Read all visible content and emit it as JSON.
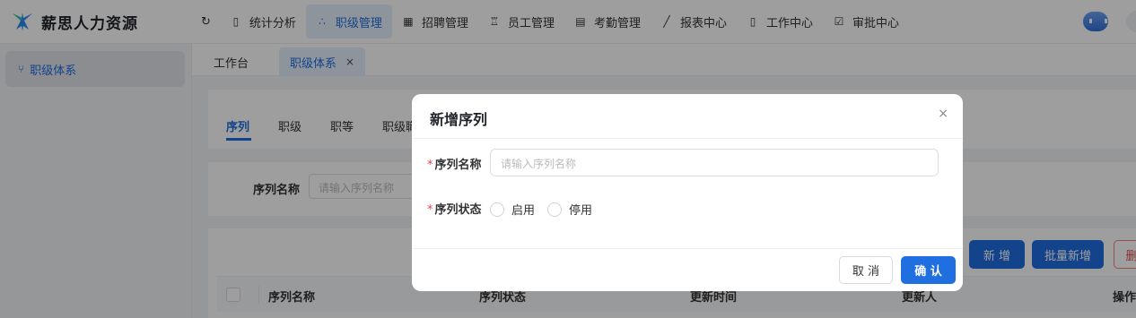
{
  "app": {
    "brand": "薪思人力资源"
  },
  "topnav": {
    "items": [
      {
        "label": "统计分析",
        "icon": "document-icon"
      },
      {
        "label": "职级管理",
        "icon": "org-icon"
      },
      {
        "label": "招聘管理",
        "icon": "grid-icon"
      },
      {
        "label": "员工管理",
        "icon": "people-icon"
      },
      {
        "label": "考勤管理",
        "icon": "calendar-icon"
      },
      {
        "label": "报表中心",
        "icon": "chart-icon"
      },
      {
        "label": "工作中心",
        "icon": "document-icon"
      },
      {
        "label": "审批中心",
        "icon": "checkbox-icon"
      }
    ],
    "active_index": 1
  },
  "sidebar": {
    "items": [
      {
        "label": "职级体系"
      }
    ]
  },
  "page_tabs": {
    "items": [
      {
        "label": "工作台"
      },
      {
        "label": "职级体系",
        "close": "×"
      }
    ]
  },
  "subtabs": {
    "items": [
      {
        "label": "序列"
      },
      {
        "label": "职级"
      },
      {
        "label": "职等"
      },
      {
        "label": "职级職"
      }
    ]
  },
  "filter": {
    "label": "序列名称",
    "placeholder": "请输入序列名称"
  },
  "toolbar": {
    "add": "新 增",
    "batch_add": "批量新增",
    "delete": "删"
  },
  "table": {
    "headers": [
      "序列名称",
      "序列状态",
      "更新时间",
      "更新人",
      "操作"
    ]
  },
  "modal": {
    "title": "新增序列",
    "close": "×",
    "name_label": "序列名称",
    "name_placeholder": "请输入序列名称",
    "status_label": "序列状态",
    "required_mark": "*",
    "options": [
      "启用",
      "停用"
    ],
    "cancel": "取 消",
    "confirm": "确 认"
  },
  "colors": {
    "accent": "#1f6fe0",
    "danger": "#e54545"
  }
}
